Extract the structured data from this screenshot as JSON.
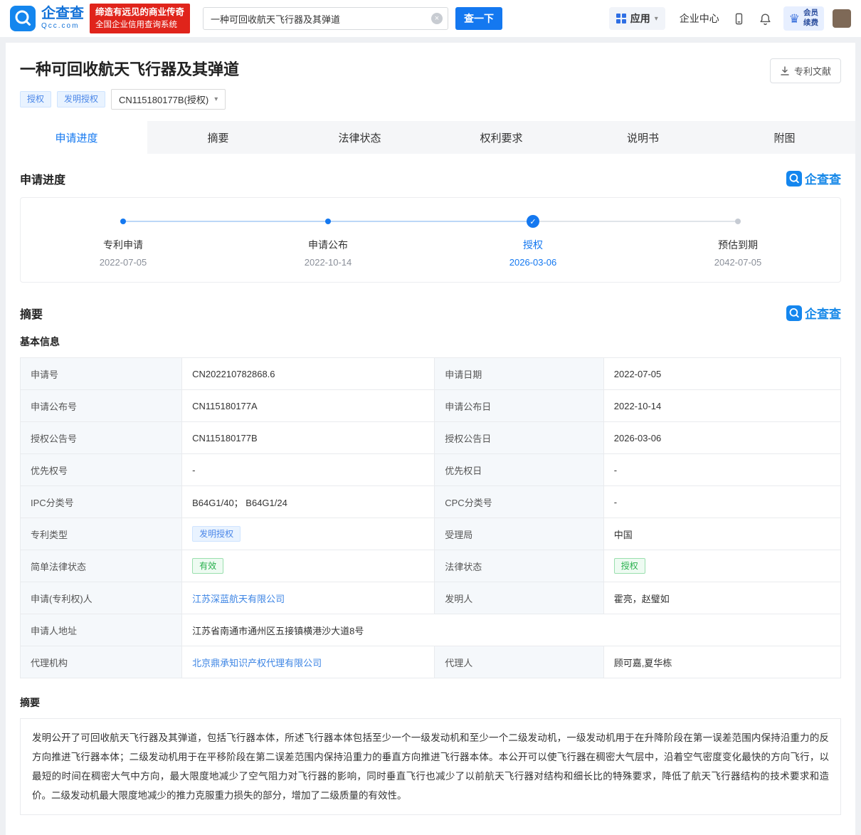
{
  "brand": {
    "name": "企查查",
    "domain": "Qcc.com",
    "slogan_line1": "缔造有远见的商业传奇",
    "slogan_line2": "全国企业信用查询系统"
  },
  "icons": {
    "caret_down": "▾",
    "check": "✓",
    "clear": "×",
    "crown": "♛"
  },
  "header": {
    "search_value": "一种可回收航天飞行器及其弹道",
    "search_button": "查一下",
    "apps_label": "应用",
    "enterprise_center": "企业中心",
    "member_line1": "会员",
    "member_line2": "续费"
  },
  "title_bar": {
    "title": "一种可回收航天飞行器及其弹道",
    "tag_status": "授权",
    "tag_type": "发明授权",
    "patent_select": "CN115180177B(授权)",
    "doc_button": "专利文献"
  },
  "tabs": [
    {
      "label": "申请进度"
    },
    {
      "label": "摘要"
    },
    {
      "label": "法律状态"
    },
    {
      "label": "权利要求"
    },
    {
      "label": "说明书"
    },
    {
      "label": "附图"
    }
  ],
  "progress": {
    "section_title": "申请进度",
    "steps": [
      {
        "label": "专利申请",
        "date": "2022-07-05",
        "state": "done"
      },
      {
        "label": "申请公布",
        "date": "2022-10-14",
        "state": "done"
      },
      {
        "label": "授权",
        "date": "2026-03-06",
        "state": "current"
      },
      {
        "label": "预估到期",
        "date": "2042-07-05",
        "state": "future"
      }
    ]
  },
  "summary": {
    "section_title": "摘要",
    "basic_info_title": "基本信息",
    "rows": [
      {
        "cells": [
          {
            "t": "label",
            "text": "申请号"
          },
          {
            "t": "text",
            "text": "CN202210782868.6"
          },
          {
            "t": "label",
            "text": "申请日期"
          },
          {
            "t": "text",
            "text": "2022-07-05"
          }
        ]
      },
      {
        "cells": [
          {
            "t": "label",
            "text": "申请公布号"
          },
          {
            "t": "text",
            "text": "CN115180177A"
          },
          {
            "t": "label",
            "text": "申请公布日"
          },
          {
            "t": "text",
            "text": "2022-10-14"
          }
        ]
      },
      {
        "cells": [
          {
            "t": "label",
            "text": "授权公告号"
          },
          {
            "t": "text",
            "text": "CN115180177B"
          },
          {
            "t": "label",
            "text": "授权公告日"
          },
          {
            "t": "text",
            "text": "2026-03-06"
          }
        ]
      },
      {
        "cells": [
          {
            "t": "label",
            "text": "优先权号"
          },
          {
            "t": "text",
            "text": "-"
          },
          {
            "t": "label",
            "text": "优先权日"
          },
          {
            "t": "text",
            "text": "-"
          }
        ]
      },
      {
        "cells": [
          {
            "t": "label",
            "text": "IPC分类号"
          },
          {
            "t": "text",
            "text": "B64G1/40； B64G1/24"
          },
          {
            "t": "label",
            "text": "CPC分类号"
          },
          {
            "t": "text",
            "text": "-"
          }
        ]
      },
      {
        "cells": [
          {
            "t": "label",
            "text": "专利类型"
          },
          {
            "t": "tagblue",
            "text": "发明授权"
          },
          {
            "t": "label",
            "text": "受理局"
          },
          {
            "t": "text",
            "text": "中国"
          }
        ]
      },
      {
        "cells": [
          {
            "t": "label",
            "text": "简单法律状态"
          },
          {
            "t": "taggreen",
            "text": "有效"
          },
          {
            "t": "label",
            "text": "法律状态"
          },
          {
            "t": "taggreen",
            "text": "授权"
          }
        ]
      },
      {
        "cells": [
          {
            "t": "label",
            "text": "申请(专利权)人"
          },
          {
            "t": "link",
            "text": "江苏深蓝航天有限公司"
          },
          {
            "t": "label",
            "text": "发明人"
          },
          {
            "t": "text",
            "text": "霍亮，赵璧如"
          }
        ]
      },
      {
        "cells": [
          {
            "t": "label",
            "text": "申请人地址"
          },
          {
            "t": "text",
            "text": "江苏省南通市通州区五接镇横港沙大道8号",
            "span": 3
          }
        ]
      },
      {
        "cells": [
          {
            "t": "label",
            "text": "代理机构"
          },
          {
            "t": "link",
            "text": "北京鼎承知识产权代理有限公司"
          },
          {
            "t": "label",
            "text": "代理人"
          },
          {
            "t": "text",
            "text": "顾可嘉,夏华栋"
          }
        ]
      }
    ],
    "abstract_title": "摘要",
    "abstract_text": "发明公开了可回收航天飞行器及其弹道，包括飞行器本体，所述飞行器本体包括至少一个一级发动机和至少一个二级发动机，一级发动机用于在升降阶段在第一误差范围内保持沿重力的反方向推进飞行器本体；二级发动机用于在平移阶段在第二误差范围内保持沿重力的垂直方向推进飞行器本体。本公开可以使飞行器在稠密大气层中，沿着空气密度变化最快的方向飞行，以最短的时间在稠密大气中方向，最大限度地减少了空气阻力对飞行器的影响，同时垂直飞行也减少了以前航天飞行器对结构和细长比的特殊要求，降低了航天飞行器结构的技术要求和造价。二级发动机最大限度地减少的推力克服重力损失的部分，增加了二级质量的有效性。"
  },
  "colors": {
    "brand_blue": "#1478f0",
    "qcc_red": "#e0241b",
    "tag_green": "#28b04d",
    "link_blue": "#3d85e4"
  }
}
